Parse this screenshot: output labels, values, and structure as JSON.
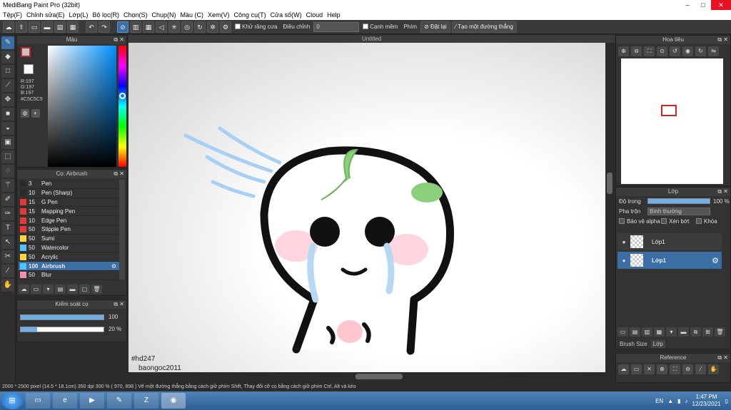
{
  "window": {
    "title": "MediBang Paint Pro (32bit)",
    "min": "–",
    "max": "□",
    "close": "✕"
  },
  "menu": [
    "Tệp(F)",
    "Chỉnh sửa(E)",
    "Lớp(L)",
    "Bộ lọc(R)",
    "Chọn(S)",
    "Chụp(N)",
    "Màu (C)",
    "Xem(V)",
    "Công cụ(T)",
    "Cửa sổ(W)",
    "Cloud",
    "Help"
  ],
  "toolbar": {
    "antialias_label": "Khử răng cưa",
    "adjust_label": "Điều chỉnh",
    "adjust_value": "0",
    "edge_label": "Cạnh mềm",
    "keys_label": "Phím",
    "reset_label": "Đặt lại",
    "line_label": "Tạo một đường thẳng"
  },
  "color_panel": {
    "title": "Màu",
    "r": "R:197",
    "g": "G:197",
    "b": "B:197",
    "hex": "#C5C5C5",
    "fg_color": "#c5c5c5",
    "accent_border": "#c0262b"
  },
  "brush_panel": {
    "title": "Cọ: Airbrush",
    "items": [
      {
        "size": "3",
        "name": "Pen",
        "color": "#2a2a2a"
      },
      {
        "size": "10",
        "name": "Pen (Sharp)",
        "color": "#2a2a2a"
      },
      {
        "size": "15",
        "name": "G Pen",
        "color": "#e53935"
      },
      {
        "size": "15",
        "name": "Mapping Pen",
        "color": "#e53935"
      },
      {
        "size": "10",
        "name": "Edge Pen",
        "color": "#e53935"
      },
      {
        "size": "50",
        "name": "Stipple Pen",
        "color": "#e53935"
      },
      {
        "size": "50",
        "name": "Sumi",
        "color": "#fdd835"
      },
      {
        "size": "50",
        "name": "Watercolor",
        "color": "#4fc3f7"
      },
      {
        "size": "50",
        "name": "Acrylic",
        "color": "#fdd835"
      },
      {
        "size": "100",
        "name": "Airbrush",
        "color": "#4fc3f7"
      },
      {
        "size": "50",
        "name": "Blur",
        "color": "#f48fb1"
      }
    ]
  },
  "brush_control": {
    "title": "Kiểm soát cọ",
    "size_value": "100",
    "size_level": 1.0,
    "opacity_value": "20 %",
    "opacity_level": 0.2
  },
  "canvas": {
    "title": "Untitled",
    "signature_1": "#hd247",
    "signature_2": "baongoc2011"
  },
  "navigator": {
    "title": "Hoa tiêu"
  },
  "layer_panel": {
    "title": "Lớp",
    "opacity_label": "Độ trong",
    "opacity_value": "100 %",
    "blend_label": "Pha trộn",
    "blend_value": "Bình thường",
    "protect_alpha": "Bảo vệ alpha",
    "clipping": "Xén bớt",
    "lock": "Khóa",
    "layers": [
      {
        "name": "Lớp1",
        "selected": false
      },
      {
        "name": "Lớp1",
        "selected": true
      }
    ],
    "tab_brush_size": "Brush Size",
    "tab_layer": "Lớp"
  },
  "reference_panel": {
    "title": "Reference"
  },
  "status": {
    "size": "2000 * 2500 pixel",
    "dims": "(14.5 * 18.1cm)",
    "dpi": "350 dpi",
    "zoom": "300 %",
    "coords": "( 970, 898 )",
    "hint": "Vẽ một đường thẳng bằng cách giữ phím Shift, Thay đổi cỡ cọ bằng cách giữ phím Ctrl, Alt và kéo"
  },
  "taskbar": {
    "lang": "EN",
    "time": "1:47 PM",
    "date": "12/23/2021"
  }
}
